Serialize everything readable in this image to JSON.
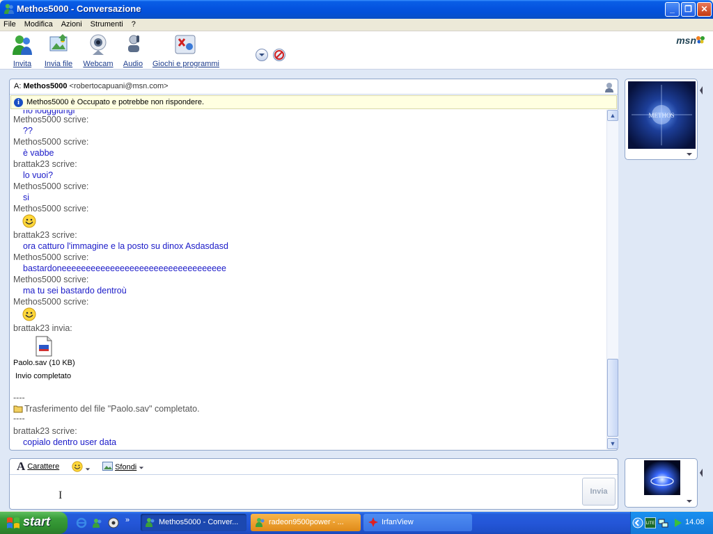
{
  "window": {
    "title": "Methos5000 - Conversazione",
    "btn_min": "_",
    "btn_max": "❐",
    "btn_close": "✕"
  },
  "menu": [
    "File",
    "Modifica",
    "Azioni",
    "Strumenti",
    "?"
  ],
  "toolbar": {
    "buttons": [
      {
        "label": "Invita",
        "icon": "invite-icon"
      },
      {
        "label": "Invia file",
        "icon": "send-file-icon"
      },
      {
        "label": "Webcam",
        "icon": "webcam-icon"
      },
      {
        "label": "Audio",
        "icon": "audio-icon"
      },
      {
        "label": "Giochi e programmi",
        "icon": "games-icon"
      }
    ],
    "logo": "msn"
  },
  "conversation": {
    "to_label": "A:",
    "to_name": "Methos5000",
    "to_email": "<robertocapuani@msn.com>",
    "status": "Methos5000 è Occupato e potrebbe non rispondere.",
    "cut_top": "no louggiungi",
    "lines": [
      {
        "type": "who",
        "text": "Methos5000 scrive:"
      },
      {
        "type": "msg",
        "text": "??"
      },
      {
        "type": "who",
        "text": "Methos5000 scrive:"
      },
      {
        "type": "msg",
        "text": "è vabbe"
      },
      {
        "type": "who",
        "text": "brattak23 scrive:"
      },
      {
        "type": "msg",
        "text": "lo vuoi?"
      },
      {
        "type": "who",
        "text": "Methos5000 scrive:"
      },
      {
        "type": "msg",
        "text": "si"
      },
      {
        "type": "who",
        "text": "Methos5000 scrive:"
      },
      {
        "type": "who",
        "text": "brattak23 scrive:"
      },
      {
        "type": "msg",
        "text": "ora catturo l'immagine e la posto su dinox Asdasdasd"
      },
      {
        "type": "who",
        "text": "Methos5000 scrive:"
      },
      {
        "type": "msg",
        "text": "bastardoneeeeeeeeeeeeeeeeeeeeeeeeeeeeeeeeee"
      },
      {
        "type": "who",
        "text": "Methos5000 scrive:"
      },
      {
        "type": "msg",
        "text": "ma tu sei bastardo dentroù"
      },
      {
        "type": "who",
        "text": "Methos5000 scrive:"
      },
      {
        "type": "who",
        "text": "brattak23 invia:"
      }
    ],
    "file_name": "Paolo.sav (10 KB)",
    "file_status": "Invio completato",
    "separator": "----",
    "transfer_msg": "Trasferimento del file \"Paolo.sav\" completato.",
    "last_who": "brattak23 scrive:",
    "last_msg": "copialo dentro user data"
  },
  "avatars": {
    "contact_text": "METHOS"
  },
  "input": {
    "font_label": "Carattere",
    "backgrounds_label": "Sfondi",
    "send_label": "Invia"
  },
  "taskbar": {
    "start": "start",
    "tasks": [
      {
        "label": "Methos5000 - Conver...",
        "active": true
      },
      {
        "label": "radeon9500power - ...",
        "active": false
      },
      {
        "label": "IrfanView",
        "active": false
      }
    ],
    "clock": "14.08",
    "tray_lite": "LITE"
  }
}
